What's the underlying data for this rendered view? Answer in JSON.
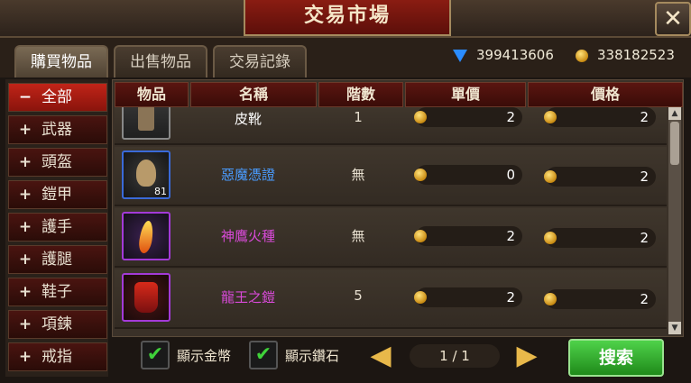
{
  "window": {
    "title": "交易市場"
  },
  "tabs": [
    {
      "label": "購買物品",
      "active": true
    },
    {
      "label": "出售物品",
      "active": false
    },
    {
      "label": "交易記錄",
      "active": false
    }
  ],
  "currency": {
    "diamonds": "399413606",
    "gold": "338182523"
  },
  "sidebar": {
    "items": [
      {
        "label": "全部",
        "sign": "−",
        "active": true
      },
      {
        "label": "武器",
        "sign": "+"
      },
      {
        "label": "頭盔",
        "sign": "+"
      },
      {
        "label": "鎧甲",
        "sign": "+"
      },
      {
        "label": "護手",
        "sign": "+"
      },
      {
        "label": "護腿",
        "sign": "+"
      },
      {
        "label": "鞋子",
        "sign": "+"
      },
      {
        "label": "項鍊",
        "sign": "+"
      },
      {
        "label": "戒指",
        "sign": "+"
      }
    ]
  },
  "table": {
    "headers": [
      "物品",
      "名稱",
      "階數",
      "單價",
      "價格"
    ],
    "rows": [
      {
        "name": "皮靴",
        "grade": "1",
        "unit_price": "2",
        "price": "2",
        "name_color": "#ffffff",
        "icon": "boots-icon"
      },
      {
        "name": "惡魔憑證",
        "grade": "無",
        "unit_price": "0",
        "price": "2",
        "name_color": "#4a9cff",
        "icon": "demon-token-icon",
        "count": "81"
      },
      {
        "name": "神鷹火種",
        "grade": "無",
        "unit_price": "2",
        "price": "2",
        "name_color": "#d94ad9",
        "icon": "flame-crystal-icon"
      },
      {
        "name": "龍王之鎧",
        "grade": "5",
        "unit_price": "2",
        "price": "2",
        "name_color": "#d94ad9",
        "icon": "dragon-armor-icon"
      }
    ]
  },
  "footer": {
    "show_gold": "顯示金幣",
    "show_diamond": "顯示鑽石",
    "page": "1 / 1",
    "search": "搜索"
  },
  "colors": {
    "accent_red": "#8a1c12",
    "search_green": "#2fa82a",
    "diamond_blue": "#2a8cff",
    "gold": "#e0a020"
  }
}
